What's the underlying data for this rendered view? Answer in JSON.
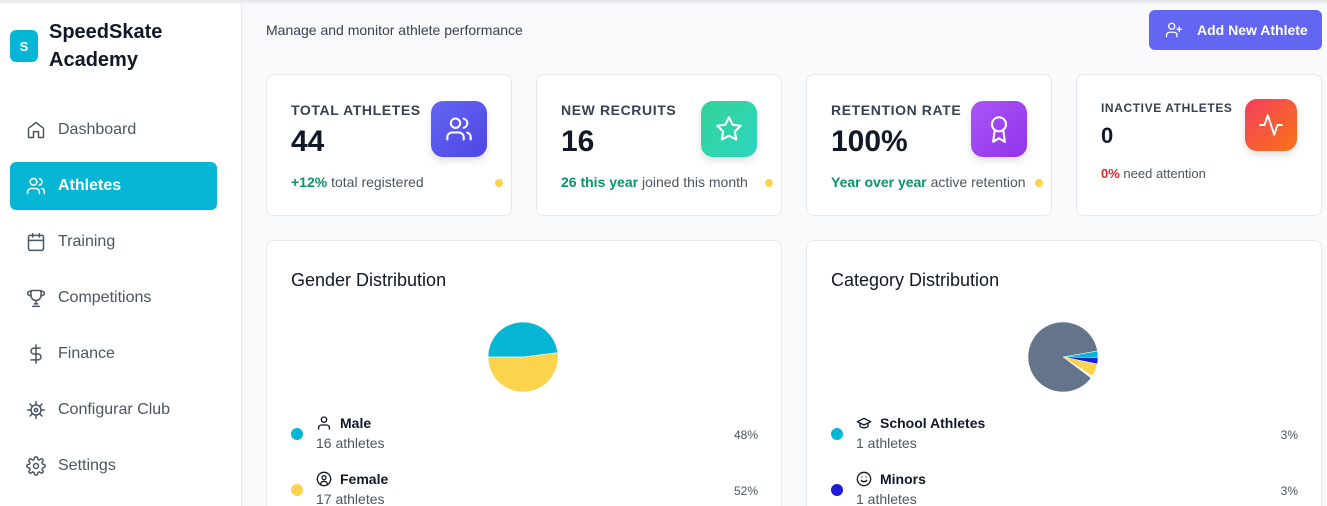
{
  "app": {
    "logo_letter": "S",
    "name": "SpeedSkate Academy"
  },
  "sidebar": {
    "items": [
      {
        "label": "Dashboard",
        "icon": "home-icon",
        "active": false
      },
      {
        "label": "Athletes",
        "icon": "users-icon",
        "active": true
      },
      {
        "label": "Training",
        "icon": "calendar-icon",
        "active": false
      },
      {
        "label": "Competitions",
        "icon": "trophy-icon",
        "active": false
      },
      {
        "label": "Finance",
        "icon": "dollar-icon",
        "active": false
      },
      {
        "label": "Configurar Club",
        "icon": "cog-icon",
        "active": false
      },
      {
        "label": "Settings",
        "icon": "settings-icon",
        "active": false
      }
    ]
  },
  "header": {
    "subtitle": "Manage and monitor athlete performance",
    "add_button": "Add New Athlete"
  },
  "stats": [
    {
      "label": "TOTAL ATHLETES",
      "value": "44",
      "highlight": "+12%",
      "text": "total registered",
      "icon": "users-icon"
    },
    {
      "label": "NEW RECRUITS",
      "value": "16",
      "highlight": "26 this year",
      "text": "joined this month",
      "icon": "star-icon"
    },
    {
      "label": "RETENTION RATE",
      "value": "100%",
      "highlight": "Year over year",
      "text": "active retention",
      "icon": "award-icon"
    },
    {
      "label": "INACTIVE ATHLETES",
      "value": "0",
      "highlight": "0%",
      "text": "need attention",
      "icon": "activity-icon"
    }
  ],
  "colors": {
    "accent": "#06b6d4",
    "indigo": "#6366f1",
    "yellow": "#fcd34d",
    "slate": "#64748b",
    "navy": "#1e1bd4"
  },
  "gender": {
    "title": "Gender Distribution",
    "items": [
      {
        "name": "Male",
        "count": "16 athletes",
        "pct": "48%",
        "value": 48,
        "color": "#06b6d4",
        "icon": "user-icon"
      },
      {
        "name": "Female",
        "count": "17 athletes",
        "pct": "52%",
        "value": 52,
        "color": "#fcd34d",
        "icon": "user-circle-icon"
      }
    ]
  },
  "category": {
    "title": "Category Distribution",
    "items": [
      {
        "name": "School Athletes",
        "count": "1 athletes",
        "pct": "3%",
        "value": 3,
        "color": "#06b6d4",
        "icon": "graduation-cap-icon"
      },
      {
        "name": "Minors",
        "count": "1 athletes",
        "pct": "3%",
        "value": 3,
        "color": "#1e1bd4",
        "icon": "smile-icon"
      }
    ],
    "pie_slices": [
      {
        "value": 3,
        "color": "#06b6d4"
      },
      {
        "value": 3,
        "color": "#1e1bd4"
      },
      {
        "value": 6,
        "color": "#fcd34d"
      },
      {
        "value": 1,
        "color": "#ffffff"
      },
      {
        "value": 87,
        "color": "#64748b"
      }
    ]
  }
}
